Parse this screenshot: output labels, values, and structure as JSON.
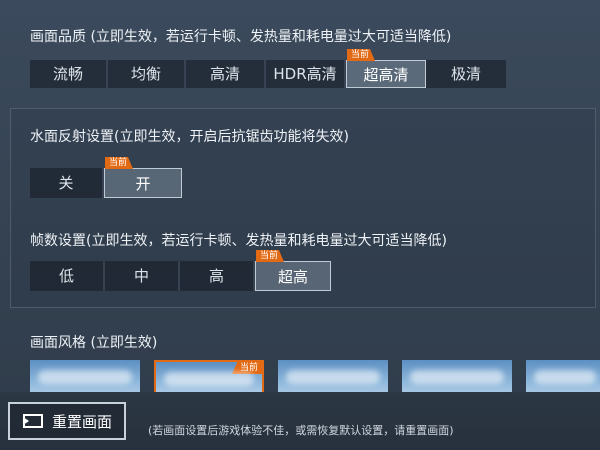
{
  "quality": {
    "title": "画面品质 (立即生效，若运行卡顿、发热量和耗电量过大可适当降低)",
    "options": [
      "流畅",
      "均衡",
      "高清",
      "HDR高清",
      "超高清",
      "极清"
    ],
    "selected": "超高清"
  },
  "current_badge": "当前",
  "water": {
    "title": "水面反射设置(立即生效，开启后抗锯齿功能将失效)",
    "options": [
      "关",
      "开"
    ],
    "selected": "开"
  },
  "fps": {
    "title": "帧数设置(立即生效，若运行卡顿、发热量和耗电量过大可适当降低)",
    "options": [
      "低",
      "中",
      "高",
      "超高"
    ],
    "selected": "超高"
  },
  "style": {
    "title": "画面风格 (立即生效)",
    "thumbnails": 5,
    "selected_index": 1
  },
  "reset": {
    "label": "重置画面",
    "hint": "(若画面设置后游戏体验不佳，或需恢复默认设置，请重置画面)"
  },
  "colors": {
    "accent": "#e36a14",
    "background": "#364454"
  },
  "icons": {
    "reset": "reset-icon"
  }
}
